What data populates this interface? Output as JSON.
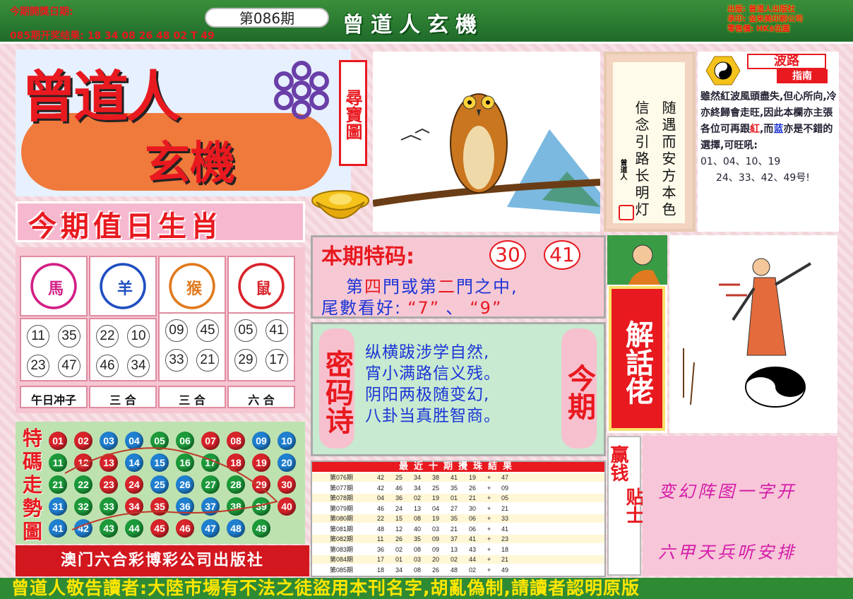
{
  "header": {
    "open_date_label": "今期開獎日期:",
    "last_result": "085期开奖结果: 18 34 08 26 48 02 T 49",
    "issue": "第086期",
    "masthead": "曾道人玄機",
    "publisher_lines": [
      "出版: 曾道人出版社",
      "承印: 金来美印刷公司",
      "零售價: HK$伍圓"
    ]
  },
  "logo": {
    "line1": "曾道人",
    "line2": "玄機",
    "seal": "尋寶圖"
  },
  "poem_box": {
    "col_right": "随遇而安方本色",
    "col_left": "信念引路长明灯",
    "signature": "曾道人"
  },
  "wave_guide": {
    "title": "波路",
    "subtitle": "指南",
    "text_a": "雖然紅波風頭盡失,但心所向,冷亦終歸會走旺,因此本欄亦主張各位可再跟",
    "red_word": "紅",
    "and_word": ",而",
    "blue_word": "蓝",
    "text_b": "亦是不錯的選擇,可旺吼:",
    "numbers_1": "01、04、10、19",
    "numbers_2": "24、33、42、49号!"
  },
  "zodiac": {
    "title": "今期值日生肖",
    "animals": [
      {
        "tag": "馬",
        "color": "#d21f85",
        "balls": [
          "11",
          "35",
          "23",
          "47"
        ],
        "label": "午日冲子"
      },
      {
        "tag": "羊",
        "color": "#1f4fc0",
        "balls": [
          "22",
          "10",
          "46",
          "34"
        ],
        "label": "三 合"
      },
      {
        "tag": "猴",
        "color": "#e07a1e",
        "balls": [
          "09",
          "45",
          "33",
          "21"
        ],
        "label": "三 合"
      },
      {
        "tag": "鼠",
        "color": "#d8232a",
        "balls": [
          "05",
          "41",
          "29",
          "17"
        ],
        "label": "六 合"
      }
    ]
  },
  "trend": {
    "label": "特碼走勢圖",
    "rows": [
      [
        [
          "01",
          "r"
        ],
        [
          "02",
          "r"
        ],
        [
          "03",
          "b"
        ],
        [
          "04",
          "b"
        ],
        [
          "05",
          "g"
        ],
        [
          "06",
          "g"
        ],
        [
          "07",
          "r"
        ],
        [
          "08",
          "r"
        ],
        [
          "09",
          "b"
        ],
        [
          "10",
          "b"
        ]
      ],
      [
        [
          "11",
          "g"
        ],
        [
          "12",
          "r"
        ],
        [
          "13",
          "r"
        ],
        [
          "14",
          "b"
        ],
        [
          "15",
          "b"
        ],
        [
          "16",
          "g"
        ],
        [
          "17",
          "g"
        ],
        [
          "18",
          "r"
        ],
        [
          "19",
          "r"
        ],
        [
          "20",
          "b"
        ]
      ],
      [
        [
          "21",
          "g"
        ],
        [
          "22",
          "g"
        ],
        [
          "23",
          "r"
        ],
        [
          "24",
          "r"
        ],
        [
          "25",
          "b"
        ],
        [
          "26",
          "b"
        ],
        [
          "27",
          "g"
        ],
        [
          "28",
          "g"
        ],
        [
          "29",
          "r"
        ],
        [
          "30",
          "r"
        ]
      ],
      [
        [
          "31",
          "b"
        ],
        [
          "32",
          "g"
        ],
        [
          "33",
          "g"
        ],
        [
          "34",
          "r"
        ],
        [
          "35",
          "r"
        ],
        [
          "36",
          "b"
        ],
        [
          "37",
          "b"
        ],
        [
          "38",
          "g"
        ],
        [
          "39",
          "g"
        ],
        [
          "40",
          "r"
        ]
      ],
      [
        [
          "41",
          "b"
        ],
        [
          "42",
          "b"
        ],
        [
          "43",
          "g"
        ],
        [
          "44",
          "g"
        ],
        [
          "45",
          "r"
        ],
        [
          "46",
          "r"
        ],
        [
          "47",
          "b"
        ],
        [
          "48",
          "b"
        ],
        [
          "49",
          "g"
        ]
      ]
    ]
  },
  "publisher_footer": "澳门六合彩博彩公司出版社",
  "special": {
    "title": "本期特码:",
    "num1": "30",
    "num2": "41",
    "line1_a": "第",
    "line1_four": "四",
    "line1_b": "門或第",
    "line1_two": "二",
    "line1_c": "門之中,",
    "line2_a": "尾數看好:",
    "tail1": "“7”",
    "sep": "、",
    "tail2": "“9”"
  },
  "code_poem": {
    "side_left": "密码诗",
    "side_right": "今期",
    "lines": [
      "纵横跋涉学自然,",
      "宵小满路信义残。",
      "阴阳两极随变幻,",
      "八卦当真胜智商。"
    ]
  },
  "results": {
    "title": "最近十期攪珠結果",
    "rows": [
      [
        "第076期",
        "42",
        "25",
        "34",
        "38",
        "41",
        "19",
        "+",
        "47"
      ],
      [
        "第077期",
        "42",
        "46",
        "34",
        "25",
        "35",
        "26",
        "+",
        "09"
      ],
      [
        "第078期",
        "04",
        "36",
        "02",
        "19",
        "01",
        "21",
        "+",
        "05"
      ],
      [
        "第079期",
        "46",
        "24",
        "13",
        "04",
        "27",
        "30",
        "+",
        "21"
      ],
      [
        "第080期",
        "22",
        "15",
        "08",
        "19",
        "35",
        "06",
        "+",
        "33"
      ],
      [
        "第081期",
        "48",
        "12",
        "40",
        "03",
        "21",
        "06",
        "+",
        "41"
      ],
      [
        "第082期",
        "11",
        "26",
        "35",
        "09",
        "37",
        "41",
        "+",
        "23"
      ],
      [
        "第083期",
        "36",
        "02",
        "08",
        "09",
        "13",
        "43",
        "+",
        "18"
      ],
      [
        "第084期",
        "17",
        "01",
        "03",
        "20",
        "02",
        "44",
        "+",
        "21"
      ],
      [
        "第085期",
        "18",
        "34",
        "08",
        "26",
        "48",
        "02",
        "+",
        "49"
      ]
    ]
  },
  "jiehua": {
    "title": "解話佬"
  },
  "tips": {
    "side1": "赢钱",
    "side2": "贴士",
    "line1": "变幻阵图一字开",
    "line2": "六甲天兵听安排"
  },
  "bottom_notice": "曾道人敬告讀者:大陸市場有不法之徒盜用本刊名字,胡亂偽制,請讀者認明原版"
}
